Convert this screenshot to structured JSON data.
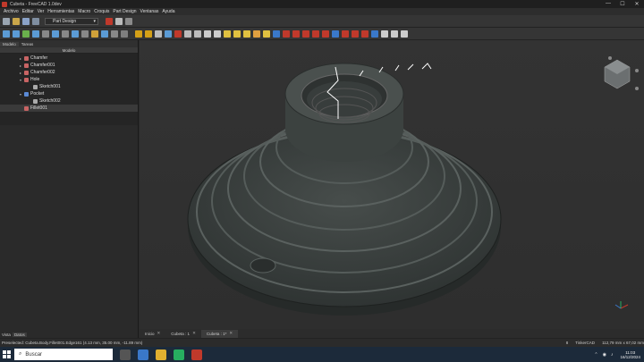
{
  "window": {
    "title": "Cubeta - FreeCAD 1.0dev",
    "min": "—",
    "max": "☐",
    "close": "✕"
  },
  "menu": [
    "Archivo",
    "Editar",
    "Ver",
    "Herramientas",
    "Macro",
    "Croquis",
    "Part Design",
    "Ventanas",
    "Ayuda"
  ],
  "workbench": {
    "selected": "Part Design"
  },
  "panel_tabs": [
    "Modelo",
    "Tareas"
  ],
  "tree_header": "Modelo",
  "tree": [
    {
      "label": "Chamfer",
      "toggle": "▸"
    },
    {
      "label": "Chamfer001",
      "toggle": "▸"
    },
    {
      "label": "Chamfer002",
      "toggle": "▸"
    },
    {
      "label": "Hole",
      "toggle": "▾"
    },
    {
      "label": "Sketch001",
      "toggle": ""
    },
    {
      "label": "Pocket",
      "toggle": "▾"
    },
    {
      "label": "Sketch002",
      "toggle": ""
    },
    {
      "label": "Fillet001",
      "toggle": ""
    }
  ],
  "bottom_tabs": [
    "Vista",
    "Datos"
  ],
  "doc_tabs": [
    {
      "label": "Inicio"
    },
    {
      "label": "Cubeta : 1"
    },
    {
      "label": "Cubeta : 1*"
    }
  ],
  "status": {
    "message": "Preselected: Cubeta.Body.Fillet001.Edge161 (4.13 mm, 35.00 mm, -11.89 mm)",
    "nav": "TinkerCAD",
    "dims": "112,79 mm x 67,02 mm",
    "counter": "8"
  },
  "taskbar": {
    "search_placeholder": "Buscar",
    "time": "11:03",
    "date": "16/12/2024"
  },
  "colors": {
    "accent": "#c0392b",
    "bg": "#2b2b2b",
    "model": "#3c4240"
  }
}
